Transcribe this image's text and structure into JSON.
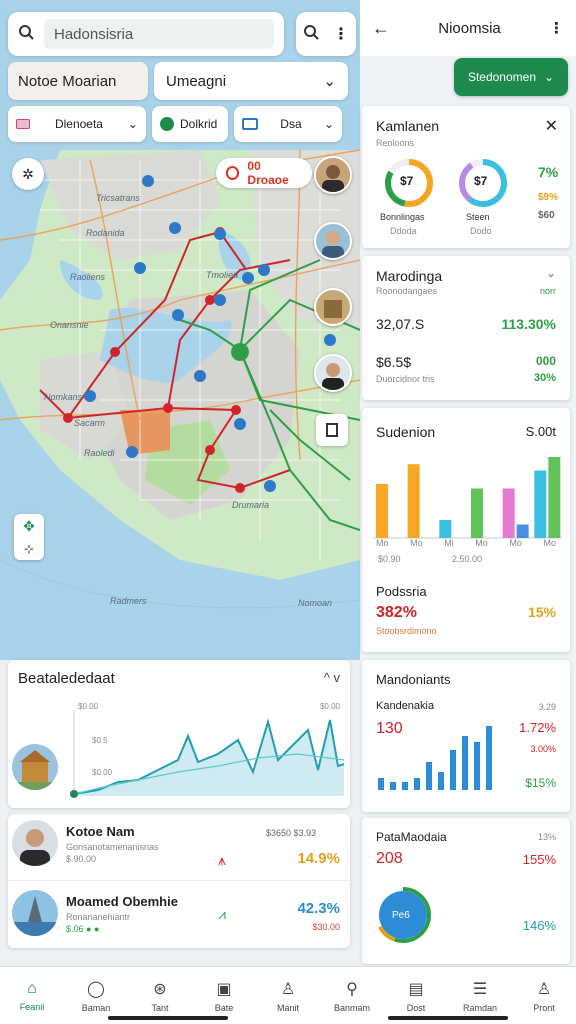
{
  "search": {
    "value": "Hadonsisria"
  },
  "dropdown_left": {
    "label": "Notoe Moarian"
  },
  "dropdown_right": {
    "value": "Umeagni"
  },
  "chips": [
    {
      "label": "Dlenoeta"
    },
    {
      "label": "Dolkrid"
    },
    {
      "label": "Dsa"
    }
  ],
  "alert_pill": {
    "label": "00 Droaoe"
  },
  "map_labels": [
    "Rodanida",
    "Raoliens",
    "Tmoliea",
    "Tricsatrans",
    "Onansnie",
    "Nomkans",
    "Sacarm",
    "Raoledi",
    "Radmers",
    "Nomoan",
    "Drumaria"
  ],
  "stats_card": {
    "title": "Beatalededaat",
    "ticks": [
      "$0.00",
      "$0.5",
      "$0.00"
    ],
    "tick_right": "$0.00",
    "chevrons": "^ v"
  },
  "people": [
    {
      "name": "Kotoe Nam",
      "sub1": "Gonsanotamenanisnas",
      "sub2": "$.90.00",
      "mid": "$3650 $3.93",
      "pct": "14.9%",
      "pct_color": "#e2a21a"
    },
    {
      "name": "Moamed Obemhie",
      "sub1": "Ronananehiantr",
      "sub2": "$.06 ● ●",
      "mid": "",
      "pct": "42.3%",
      "pct_color": "#2a8fd0",
      "pct2": "$30.00"
    }
  ],
  "right_panel": {
    "header_title": "Nioomsia",
    "green_button": "Stedonomen",
    "card1": {
      "title": "Kamlanen",
      "sub": "Reoloons",
      "g1_val": "$7",
      "g1_sub": "Bonnlingas",
      "g1_sub2": "Ddoda",
      "g2_val": "$7",
      "g2_sub": "Steen",
      "g2_sub2": "Dodo",
      "side_top": "7%",
      "side_mid": "$9%",
      "side_bot": "$60"
    },
    "card2": {
      "title": "Marodinga",
      "sub": "Roonodangaes",
      "right_sub": "norr",
      "v1": "32,07.S",
      "v1_pct": "113.30%",
      "v2": "$6.5$",
      "v2_sub": "Duorcidnor tris",
      "v2_pct": "000",
      "v2_pct2": "30%"
    },
    "card3": {
      "title": "Sudenion",
      "right": "S.00t",
      "labels": [
        "Mo",
        "Mo",
        "Mi",
        "Mo",
        "Mo",
        "Mo"
      ],
      "labels2": [
        "$0.90",
        "2.50.00"
      ],
      "sub_title": "Podssria",
      "big": "382%",
      "big_sub": "Stoobsrdimono",
      "pct": "15%"
    },
    "card4": {
      "title": "Mandoniants",
      "sub": "Kandenakia",
      "sub_r": "3.29",
      "big": "130",
      "pct": "1.72%",
      "pct2": "3.00%",
      "pct3": "$15%"
    },
    "card5": {
      "title": "PataMaodaia",
      "sub_r": "13%",
      "big": "208",
      "pct": "155%",
      "donut_label": "Pe6",
      "pct2": "146%"
    }
  },
  "nav": [
    {
      "label": "Feanil",
      "active": true
    },
    {
      "label": "Baman",
      "active": false
    },
    {
      "label": "Tant",
      "active": false
    },
    {
      "label": "Bate",
      "active": false
    },
    {
      "label": "Manit",
      "active": false
    },
    {
      "label": "Banmam",
      "active": false
    },
    {
      "label": "Dost",
      "active": false
    },
    {
      "label": "Ramdan",
      "active": false
    },
    {
      "label": "Pront",
      "active": false
    }
  ],
  "chart_data": {
    "type": "bar",
    "categories": [
      "Mo",
      "Mo",
      "Mi",
      "Mo",
      "Mo",
      "Mo"
    ],
    "series": [
      {
        "values": [
          60,
          82,
          20,
          55,
          55,
          75
        ]
      },
      {
        "values": [
          0,
          0,
          0,
          0,
          15,
          90
        ]
      }
    ],
    "colors": [
      "#f5a623",
      "#f5a623",
      "#3bbfe0",
      "#62c25a",
      "#e57bd0",
      "#4a90e2",
      "#3bbfe0",
      "#62c25a",
      "#b88ae6"
    ]
  },
  "colors": {
    "accent_green": "#1f8a4d",
    "red_route": "#d0242b",
    "green_route": "#2e9e46"
  }
}
